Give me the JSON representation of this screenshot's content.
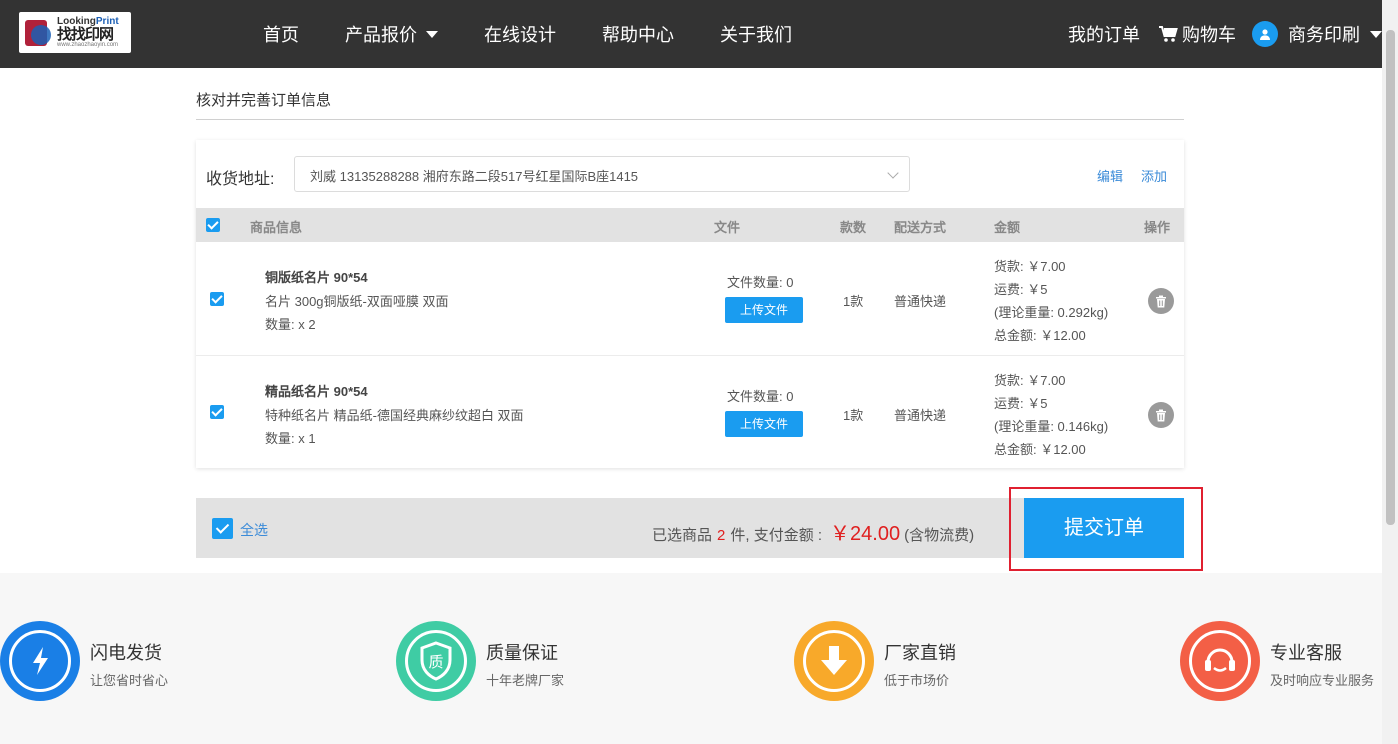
{
  "header": {
    "logo_en_1": "Looking",
    "logo_en_2": "Print",
    "logo_cn": "找找印网",
    "logo_url": "www.zhaozhaoyin.com",
    "nav": [
      "首页",
      "产品报价",
      "在线设计",
      "帮助中心",
      "关于我们"
    ],
    "my_orders": "我的订单",
    "cart": "购物车",
    "user": "商务印刷"
  },
  "page": {
    "title": "核对并完善订单信息"
  },
  "address": {
    "label": "收货地址:",
    "value": "刘威 13135288288 湘府东路二段517号红星国际B座1415",
    "edit": "编辑",
    "add": "添加"
  },
  "table": {
    "headers": {
      "product": "商品信息",
      "file": "文件",
      "count": "款数",
      "shipping": "配送方式",
      "amount": "金额",
      "action": "操作"
    },
    "rows": [
      {
        "name": "铜版纸名片 90*54",
        "desc": "名片 300g铜版纸-双面哑膜 双面",
        "qty": "数量: x 2",
        "file_count": "文件数量: 0",
        "upload": "上传文件",
        "kuan": "1款",
        "shipping": "普通快递",
        "goods": "货款: ￥7.00",
        "freight": "运费: ￥5",
        "weight": "(理论重量: 0.292kg)",
        "total": "总金额: ￥12.00"
      },
      {
        "name": "精品纸名片 90*54",
        "desc": "特种纸名片 精品纸-德国经典麻纱纹超白 双面",
        "qty": "数量: x 1",
        "file_count": "文件数量: 0",
        "upload": "上传文件",
        "kuan": "1款",
        "shipping": "普通快递",
        "goods": "货款: ￥7.00",
        "freight": "运费: ￥5",
        "weight": "(理论重量: 0.146kg)",
        "total": "总金额: ￥12.00"
      }
    ]
  },
  "footer_bar": {
    "select_all": "全选",
    "selected_prefix": "已选商品",
    "selected_count": "2",
    "selected_suffix": "件,  支付金额 :",
    "total": "￥24.00",
    "incl": "(含物流费)",
    "submit": "提交订单"
  },
  "features": [
    {
      "title": "闪电发货",
      "sub": "让您省时省心",
      "color": "#1a7fe6",
      "icon": "lightning-icon"
    },
    {
      "title": "质量保证",
      "sub": "十年老牌厂家",
      "color": "#3fcca4",
      "icon": "quality-shield-icon",
      "glyph": "质"
    },
    {
      "title": "厂家直销",
      "sub": "低于市场价",
      "color": "#f8a92a",
      "icon": "download-arrow-icon"
    },
    {
      "title": "专业客服",
      "sub": "及时响应专业服务",
      "color": "#f35f46",
      "icon": "headset-icon"
    }
  ],
  "colors": {
    "header_bg": "#333333",
    "accent": "#1a9cf0",
    "price_red": "#e02020",
    "highlight_border": "#e02030"
  }
}
